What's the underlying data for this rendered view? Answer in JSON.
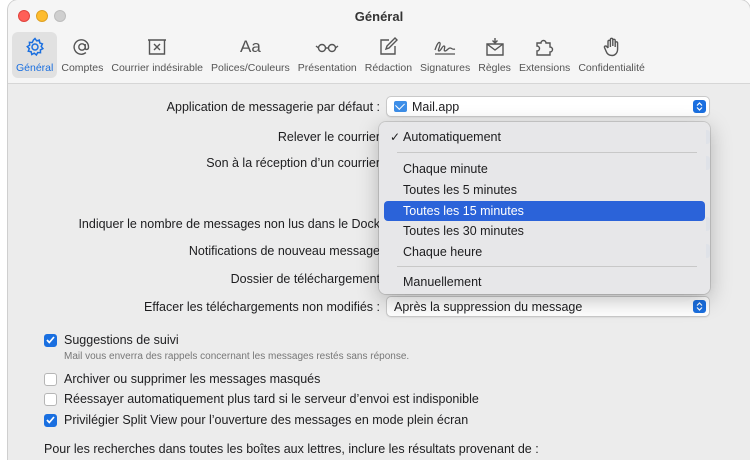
{
  "window": {
    "title": "Général"
  },
  "toolbar": {
    "items": [
      {
        "label": "Général",
        "icon": "gear-icon",
        "active": true
      },
      {
        "label": "Comptes",
        "icon": "at-icon"
      },
      {
        "label": "Courrier indésirable",
        "icon": "junk-tray-icon"
      },
      {
        "label": "Polices/Couleurs",
        "icon": "font-icon",
        "glyph": "Aa"
      },
      {
        "label": "Présentation",
        "icon": "glasses-icon"
      },
      {
        "label": "Rédaction",
        "icon": "compose-icon"
      },
      {
        "label": "Signatures",
        "icon": "signature-icon"
      },
      {
        "label": "Règles",
        "icon": "rules-envelope-icon"
      },
      {
        "label": "Extensions",
        "icon": "puzzle-icon"
      },
      {
        "label": "Confidentialité",
        "icon": "hand-icon"
      }
    ]
  },
  "settings": {
    "default_app_label": "Application de messagerie par défaut :",
    "default_app_value": "Mail.app",
    "check_mail_label": "Relever le courrier",
    "sound_label": "Son à la réception d’un courrier",
    "unread_dock_label": "Indiquer le nombre de messages non lus dans le Dock",
    "notifications_label": "Notifications de nouveau message",
    "download_folder_label": "Dossier de téléchargement",
    "remove_downloads_label": "Effacer les téléchargements non modifiés :",
    "remove_downloads_value": "Après la suppression du message"
  },
  "dropdown": {
    "items": [
      {
        "label": "Automatiquement",
        "checked": true
      },
      {
        "label": "Chaque minute"
      },
      {
        "label": "Toutes les 5 minutes"
      },
      {
        "label": "Toutes les 15 minutes",
        "highlighted": true
      },
      {
        "label": "Toutes les 30 minutes"
      },
      {
        "label": "Chaque heure"
      },
      {
        "label": "Manuellement"
      }
    ]
  },
  "checkboxes": [
    {
      "label": "Suggestions de suivi",
      "checked": true,
      "hint": "Mail vous enverra des rappels concernant les messages restés sans réponse."
    },
    {
      "label": "Archiver ou supprimer les messages masqués",
      "checked": false
    },
    {
      "label": "Réessayer automatiquement plus tard si le serveur d’envoi est indisponible",
      "checked": false
    },
    {
      "label": "Privilégier Split View pour l’ouverture des messages en mode plein écran",
      "checked": true
    }
  ],
  "footer": {
    "search_text": "Pour les recherches dans toutes les boîtes aux lettres, inclure les résultats provenant de :"
  },
  "colors": {
    "accent": "#1a6fe0",
    "menu_highlight": "#2b63d9",
    "window_bg": "#ececec"
  }
}
